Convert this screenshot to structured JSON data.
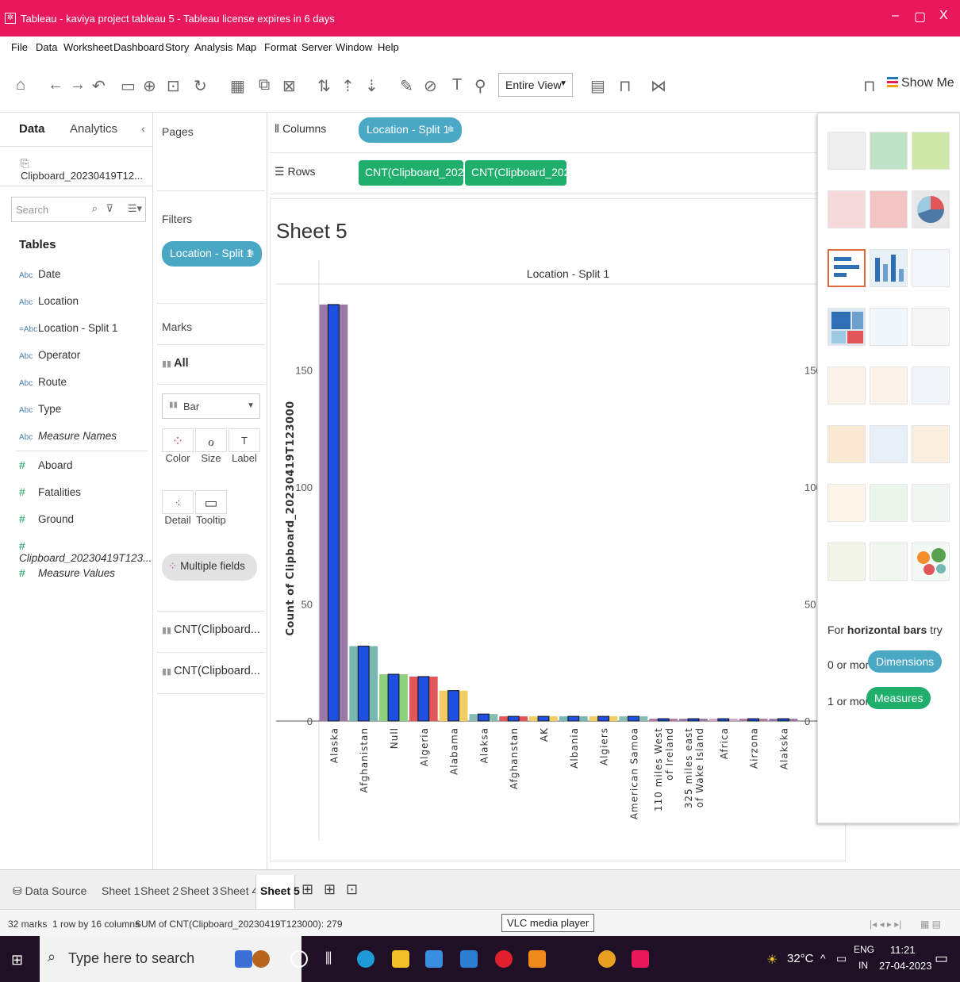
{
  "window": {
    "title": "Tableau - kaviya project tableau 5 - Tableau license expires in 6 days",
    "minimize": "–",
    "restore": "▢",
    "close": "X"
  },
  "menu": [
    "File",
    "Data",
    "Worksheet",
    "Dashboard",
    "Story",
    "Analysis",
    "Map",
    "Format",
    "Server",
    "Window",
    "Help"
  ],
  "toolbar": {
    "view_mode": "Entire View",
    "show_me_label": "Show Me"
  },
  "data_pane": {
    "tab_data": "Data",
    "tab_analytics": "Analytics",
    "datasource": "Clipboard_20230419T12...",
    "search_placeholder": "Search",
    "tables_heading": "Tables",
    "fields": [
      {
        "type": "Abc",
        "name": "Date"
      },
      {
        "type": "Abc",
        "name": "Location"
      },
      {
        "type": "=Abc",
        "name": "Location - Split 1"
      },
      {
        "type": "Abc",
        "name": "Operator"
      },
      {
        "type": "Abc",
        "name": "Route"
      },
      {
        "type": "Abc",
        "name": "Type"
      },
      {
        "type": "Abc",
        "name": "Measure Names"
      },
      {
        "type": "#",
        "name": "Aboard"
      },
      {
        "type": "#",
        "name": "Fatalities"
      },
      {
        "type": "#",
        "name": "Ground"
      },
      {
        "type": "#",
        "name": "Clipboard_20230419T123..."
      },
      {
        "type": "#",
        "name": "Measure Values"
      }
    ]
  },
  "pages_label": "Pages",
  "filters_label": "Filters",
  "filter_pill": "Location - Split 1",
  "marks": {
    "label": "Marks",
    "all": "All",
    "mark_type": "Bar",
    "buttons": [
      "Color",
      "Size",
      "Label",
      "Detail",
      "Tooltip"
    ],
    "color_field": "Multiple fields",
    "measures": [
      "CNT(Clipboard...",
      "CNT(Clipboard..."
    ]
  },
  "shelves": {
    "columns_label": "Columns",
    "rows_label": "Rows",
    "columns_pill": "Location - Split 1",
    "rows_pills": [
      "CNT(Clipboard_2023..",
      "CNT(Clipboard_2023.."
    ]
  },
  "sheet": {
    "title": "Sheet 5",
    "header": "Location - Split 1"
  },
  "chart_data": {
    "type": "bar",
    "title": "Sheet 5",
    "column_header": "Location - Split 1",
    "ylabel": "Count of Clipboard_20230419T123000",
    "ylim": [
      0,
      180
    ],
    "yticks": [
      0,
      50,
      100,
      150
    ],
    "categories": [
      "Alaska",
      "Afghanistan",
      "Null",
      "Algeria",
      "Alabama",
      "Alaksa",
      "Afghanstan",
      "AK",
      "Albania",
      "Algiers",
      "American Samoa",
      "110 miles West of Ireland",
      "325 miles east of Wake Island",
      "Africa",
      "Airzona",
      "Alakska"
    ],
    "series": [
      {
        "name": "CNT(Clipboard_2023..",
        "values": [
          178,
          32,
          20,
          19,
          13,
          3,
          2,
          2,
          2,
          2,
          2,
          1,
          1,
          1,
          1,
          1
        ]
      },
      {
        "name": "CNT(Clipboard_2023..",
        "values": [
          178,
          32,
          20,
          19,
          13,
          3,
          2,
          2,
          2,
          2,
          2,
          1,
          1,
          1,
          1,
          1
        ]
      }
    ],
    "bar_colors": [
      "#9a79a8",
      "#76b7b2",
      "#8cd17d",
      "#e15759",
      "#f1ce63",
      "#86bcb6",
      "#e15759",
      "#f1ce63",
      "#76b7b2",
      "#f1ce63",
      "#86bcb6",
      "#b07aa1",
      "#9a79a8",
      "#d4a6c8",
      "#b07aa1",
      "#9a79a8"
    ],
    "inner_bar_color": "#1f4fe0"
  },
  "show_me": {
    "hint_prefix": "For",
    "hint_bold": "horizontal bars",
    "hint_suffix": "try",
    "dims_prefix": "0 or more",
    "dims_pill": "Dimensions",
    "meas_prefix": "1 or more",
    "meas_pill": "Measures"
  },
  "sheet_tabs": {
    "data_source": "Data Source",
    "tabs": [
      "Sheet 1",
      "Sheet 2",
      "Sheet 3",
      "Sheet 4",
      "Sheet 5"
    ],
    "active": "Sheet 5"
  },
  "status": {
    "marks": "32 marks",
    "rows_cols": "1 row by 16 columns",
    "sum": "SUM of CNT(Clipboard_20230419T123000): 279"
  },
  "tooltip": "VLC media player",
  "taskbar": {
    "search_placeholder": "Type here to search",
    "weather": "32°C",
    "lang": "ENG",
    "region": "IN",
    "time": "11:21",
    "date": "27-04-2023"
  }
}
